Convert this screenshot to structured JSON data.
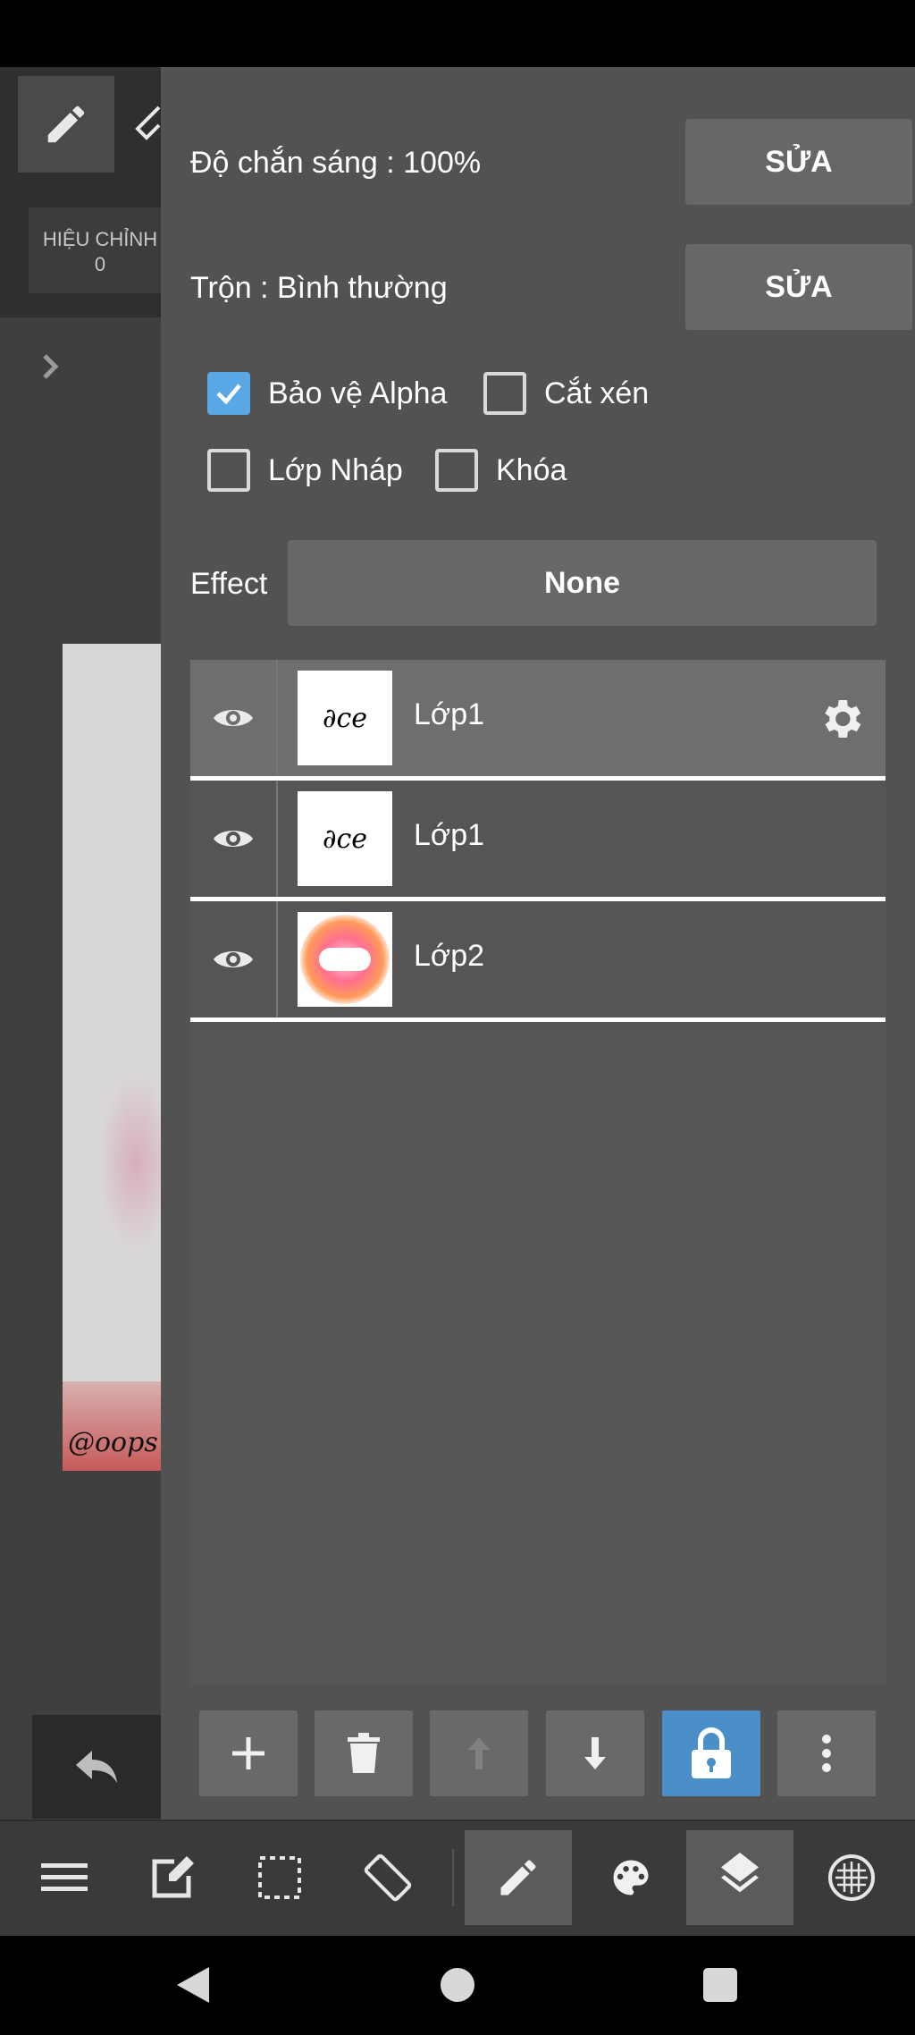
{
  "adjust": {
    "label": "HIỆU CHỈNH",
    "value": "0"
  },
  "opacity": {
    "label": "Độ chắn sáng : 100%",
    "edit": "SỬA"
  },
  "blend": {
    "label": "Trộn : Bình thường",
    "edit": "SỬA"
  },
  "checkboxes": [
    {
      "label": "Bảo vệ Alpha",
      "checked": true
    },
    {
      "label": "Cắt xén",
      "checked": false
    },
    {
      "label": "Lớp Nháp",
      "checked": false
    },
    {
      "label": "Khóa",
      "checked": false
    }
  ],
  "effect": {
    "label": "Effect",
    "value": "None"
  },
  "layers": [
    {
      "name": "Lớp1",
      "thumb_text": "∂ce",
      "selected": true
    },
    {
      "name": "Lớp1",
      "thumb_text": "∂ce",
      "selected": false
    },
    {
      "name": "Lớp2",
      "thumb_text": "",
      "selected": false
    }
  ],
  "canvas": {
    "signature": "@oops"
  },
  "colors": {
    "panel": "#525252",
    "accent": "#4a8fc8",
    "check": "#5aa9e6"
  }
}
